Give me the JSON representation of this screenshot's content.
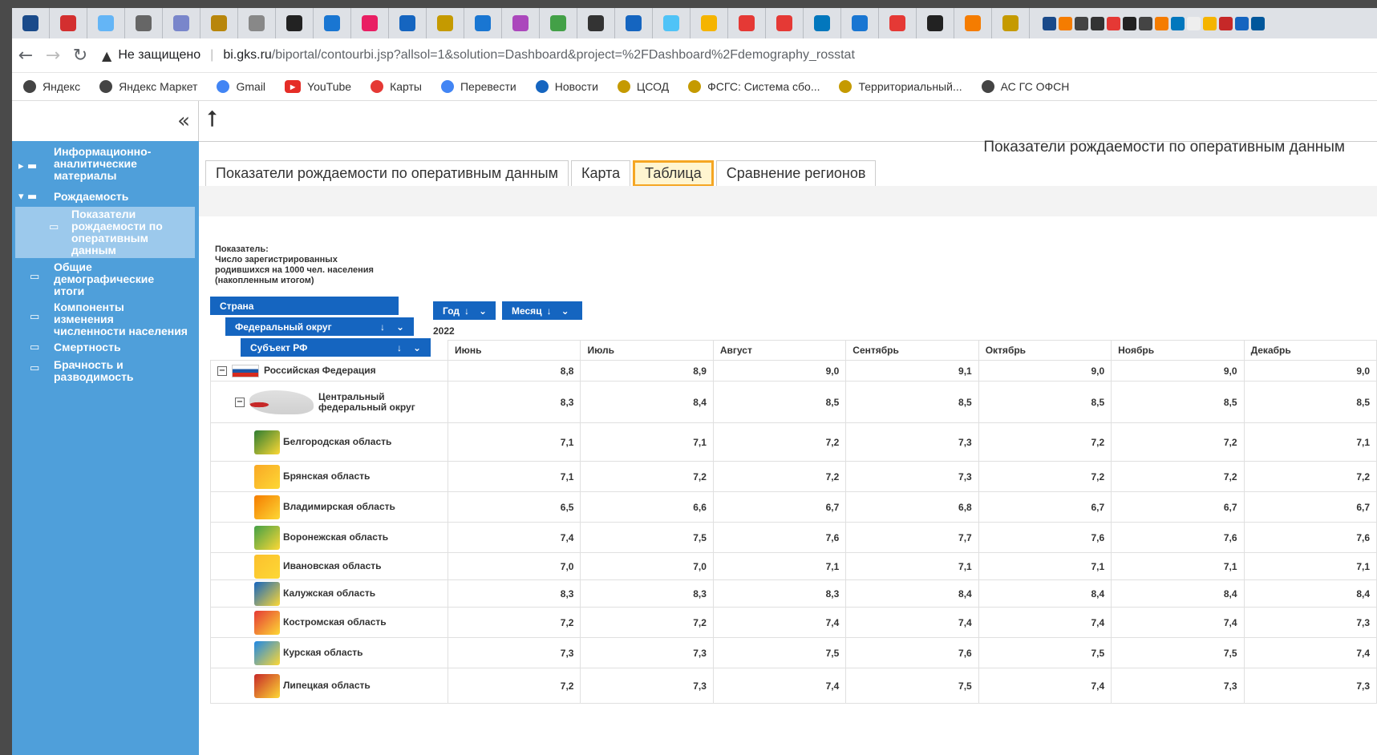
{
  "browser": {
    "tab_icons": [
      "grid-app",
      "ru-flag",
      "tile",
      "stack",
      "eagle",
      "eagle-gold",
      "google-g",
      "letter-l",
      "circle-blue",
      "heart",
      "mail",
      "eagle-small",
      "lines",
      "flower",
      "check",
      "globe",
      "mail2",
      "smile",
      "badge",
      "red-square",
      "red-square2",
      "t-letter",
      "circle-blue2",
      "red-square3",
      "diamond",
      "swirl",
      "coat"
    ],
    "security_label": "Не защищено",
    "url_host": "bi.gks.ru",
    "url_path": "/biportal/contourbi.jsp?allsol=1&solution=Dashboard&project=%2FDashboard%2Fdemography_rosstat",
    "bookmarks": [
      {
        "label": "Яндекс",
        "icon": "globe-icon"
      },
      {
        "label": "Яндекс Маркет",
        "icon": "globe-icon"
      },
      {
        "label": "Gmail",
        "icon": "google-icon"
      },
      {
        "label": "YouTube",
        "icon": "youtube-icon"
      },
      {
        "label": "Карты",
        "icon": "map-pin-icon"
      },
      {
        "label": "Перевести",
        "icon": "translate-icon"
      },
      {
        "label": "Новости",
        "icon": "news-icon"
      },
      {
        "label": "ЦСОД",
        "icon": "eagle-icon"
      },
      {
        "label": "ФСГС: Система сбо...",
        "icon": "eagle-icon"
      },
      {
        "label": "Территориальный...",
        "icon": "eagle-icon"
      },
      {
        "label": "АС ГС ОФСН",
        "icon": "globe-icon"
      }
    ]
  },
  "sidebar": {
    "items": [
      {
        "label_lines": [
          "Информационно-",
          "аналитические",
          "материалы"
        ]
      },
      {
        "label_lines": [
          "Рождаемость"
        ]
      },
      {
        "label_lines": [
          "Показатели",
          "рождаемости по",
          "оперативным",
          "данным"
        ]
      },
      {
        "label_lines": [
          "Общие",
          "демографические",
          "итоги"
        ]
      },
      {
        "label_lines": [
          "Компоненты",
          "изменения",
          "численности населения"
        ]
      },
      {
        "label_lines": [
          "Смертность"
        ]
      },
      {
        "label_lines": [
          "Брачность и",
          "разводимость"
        ]
      }
    ]
  },
  "dashboard": {
    "title": "Показатели рождаемости по оперативным данным",
    "tabs": [
      "Показатели рождаемости по оперативным данным",
      "Карта",
      "Таблица",
      "Сравнение регионов"
    ],
    "active_tab": "Таблица",
    "indicator_lines": [
      "Показатель:",
      "Число зарегистрированных",
      "родившихся на 1000 чел. населения",
      "(накопленным итогом)"
    ],
    "dims": {
      "country": "Страна",
      "district": "Федеральный округ",
      "subject": "Субъект РФ",
      "year": "Год",
      "month": "Месяц",
      "sort_arrow": "↓"
    },
    "year": "2022",
    "months": [
      "Июнь",
      "Июль",
      "Август",
      "Сентябрь",
      "Октябрь",
      "Ноябрь",
      "Декабрь"
    ],
    "rows": [
      {
        "name": "Российская Федерация",
        "type": "country",
        "values": [
          "8,8",
          "8,9",
          "9,0",
          "9,1",
          "9,0",
          "9,0",
          "9,0"
        ]
      },
      {
        "name": "Центральный федеральный округ",
        "type": "district",
        "values": [
          "8,3",
          "8,4",
          "8,5",
          "8,5",
          "8,5",
          "8,5",
          "8,5"
        ]
      },
      {
        "name": "Белгородская область",
        "type": "region",
        "values": [
          "7,1",
          "7,1",
          "7,2",
          "7,3",
          "7,2",
          "7,2",
          "7,1"
        ]
      },
      {
        "name": "Брянская область",
        "type": "region",
        "values": [
          "7,1",
          "7,2",
          "7,2",
          "7,3",
          "7,2",
          "7,2",
          "7,2"
        ]
      },
      {
        "name": "Владимирская область",
        "type": "region",
        "values": [
          "6,5",
          "6,6",
          "6,7",
          "6,8",
          "6,7",
          "6,7",
          "6,7"
        ]
      },
      {
        "name": "Воронежская область",
        "type": "region",
        "values": [
          "7,4",
          "7,5",
          "7,6",
          "7,7",
          "7,6",
          "7,6",
          "7,6"
        ]
      },
      {
        "name": "Ивановская область",
        "type": "region",
        "values": [
          "7,0",
          "7,0",
          "7,1",
          "7,1",
          "7,1",
          "7,1",
          "7,1"
        ]
      },
      {
        "name": "Калужская область",
        "type": "region",
        "values": [
          "8,3",
          "8,3",
          "8,3",
          "8,4",
          "8,4",
          "8,4",
          "8,4"
        ]
      },
      {
        "name": "Костромская область",
        "type": "region",
        "values": [
          "7,2",
          "7,2",
          "7,4",
          "7,4",
          "7,4",
          "7,4",
          "7,3"
        ]
      },
      {
        "name": "Курская область",
        "type": "region",
        "values": [
          "7,3",
          "7,3",
          "7,5",
          "7,6",
          "7,5",
          "7,5",
          "7,4"
        ]
      },
      {
        "name": "Липецкая область",
        "type": "region",
        "values": [
          "7,2",
          "7,3",
          "7,4",
          "7,5",
          "7,4",
          "7,3",
          "7,3"
        ]
      }
    ]
  }
}
